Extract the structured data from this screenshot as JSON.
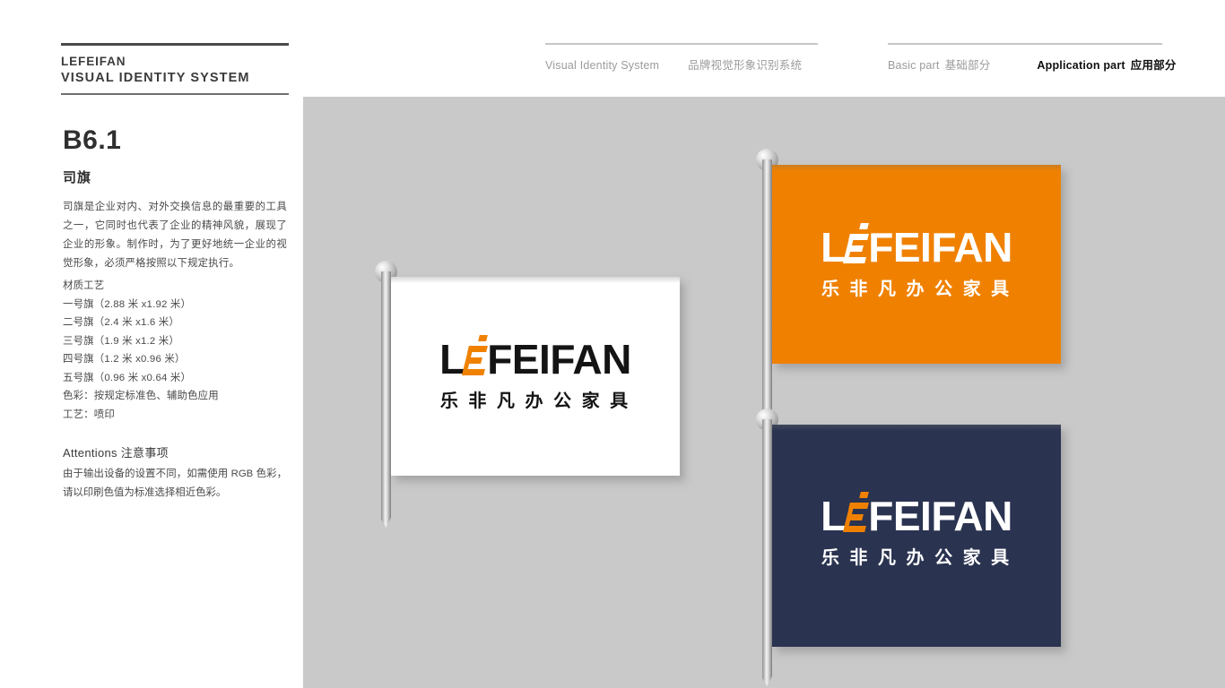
{
  "header": {
    "brand_name": "LEFEIFAN",
    "brand_sub": "VISUAL IDENTITY SYSTEM",
    "vis_en": "Visual Identity System",
    "vis_cn": "品牌视觉形象识别系统",
    "basic_en": "Basic part",
    "basic_cn": "基础部分",
    "application_en": "Application part",
    "application_cn": "应用部分"
  },
  "section": {
    "number": "B6.1",
    "title": "司旗",
    "paragraph": "司旗是企业对内、对外交换信息的最重要的工具之一，它同时也代表了企业的精神风貌，展现了企业的形象。制作时，为了更好地统一企业的视觉形象，必须严格按照以下规定执行。",
    "spec_heading": "材质工艺",
    "specs": [
      "一号旗（2.88 米 x1.92 米）",
      "二号旗（2.4 米 x1.6 米）",
      "三号旗（1.9 米 x1.2 米）",
      "四号旗（1.2 米 x0.96 米）",
      "五号旗（0.96 米 x0.64 米）",
      "色彩：按规定标准色、辅助色应用",
      "工艺：喷印"
    ],
    "attentions_title": "Attentions 注意事项",
    "attentions_body": "由于输出设备的设置不同，如需使用 RGB 色彩，请以印刷色值为标准选择相近色彩。"
  },
  "logo": {
    "wordmark_left": "L",
    "wordmark_right": "FEIFAN",
    "chinese": "乐 非 凡 办 公 家 具"
  },
  "colors": {
    "orange": "#F08100",
    "navy": "#2A3350",
    "canvas_gray": "#C9C9C9",
    "logo_black": "#141414",
    "white": "#FFFFFF"
  },
  "flags": [
    {
      "name": "white-flag",
      "background": "#FFFFFF",
      "word_color": "#141414",
      "cn_color": "#141414",
      "emark_color": "#F08100"
    },
    {
      "name": "orange-flag",
      "background": "#F08100",
      "word_color": "#FFFFFF",
      "cn_color": "#FFFFFF",
      "emark_color": "#FFFFFF"
    },
    {
      "name": "navy-flag",
      "background": "#2A3350",
      "word_color": "#FFFFFF",
      "cn_color": "#FFFFFF",
      "emark_color": "#F08100"
    }
  ]
}
